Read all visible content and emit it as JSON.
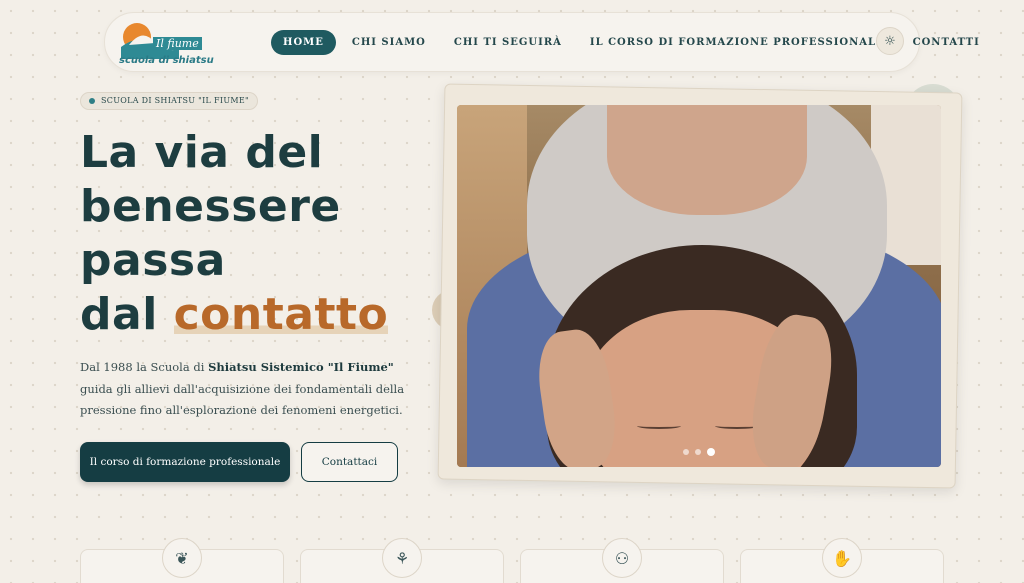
{
  "header": {
    "logo_brand": "Il fiume",
    "logo_text": "scuola di shiatsu",
    "nav": [
      {
        "label": "HOME",
        "active": true
      },
      {
        "label": "CHI SIAMO",
        "active": false
      },
      {
        "label": "CHI TI SEGUIRÀ",
        "active": false
      },
      {
        "label": "IL CORSO DI FORMAZIONE PROFESSIONALE",
        "active": false
      },
      {
        "label": "CONTATTI",
        "active": false
      }
    ],
    "theme_icon": "sun-icon"
  },
  "hero": {
    "badge": "SCUOLA DI SHIATSU \"IL FIUME\"",
    "title_line1": "La via del",
    "title_line2": "benessere",
    "title_line3": "passa",
    "title_line4_prefix": "dal ",
    "title_line4_accent": "contatto",
    "desc_part1": "Dal 1988 la Scuola di ",
    "desc_bold": "Shiatsu Sistemico \"Il Fiume\"",
    "desc_part2": " guida gli allievi dall'acquisizione dei fondamentali della pressione fino all'esplorazione dei fenomeni energetici.",
    "primary_button": "Il corso di formazione professionale",
    "secondary_button": "Contattaci"
  },
  "carousel": {
    "slide_count": 3,
    "active_slide": 3
  },
  "features": [
    {
      "icon": "leaf-hand-icon"
    },
    {
      "icon": "sprout-icon"
    },
    {
      "icon": "people-icon"
    },
    {
      "icon": "hand-wave-icon"
    }
  ],
  "colors": {
    "primary": "#153d43",
    "accent": "#b8692a",
    "background": "#f3efe8"
  }
}
